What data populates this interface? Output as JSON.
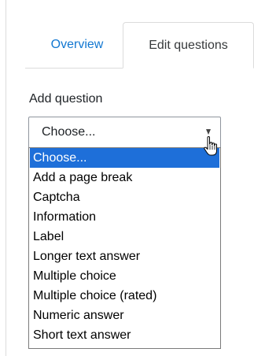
{
  "tabs": {
    "overview": "Overview",
    "edit_questions": "Edit questions",
    "active": "edit_questions"
  },
  "add_question": {
    "label": "Add question",
    "selected_value": "Choose...",
    "options": [
      "Choose...",
      "Add a page break",
      "Captcha",
      "Information",
      "Label",
      "Longer text answer",
      "Multiple choice",
      "Multiple choice (rated)",
      "Numeric answer",
      "Short text answer"
    ],
    "highlighted_index": 0
  },
  "colors": {
    "link": "#1177d1",
    "highlight": "#1e6fd9",
    "border": "#dcdcdc"
  },
  "icons": {
    "cursor": "hand-pointer-icon",
    "select_arrow": "chevron-down-icon"
  }
}
